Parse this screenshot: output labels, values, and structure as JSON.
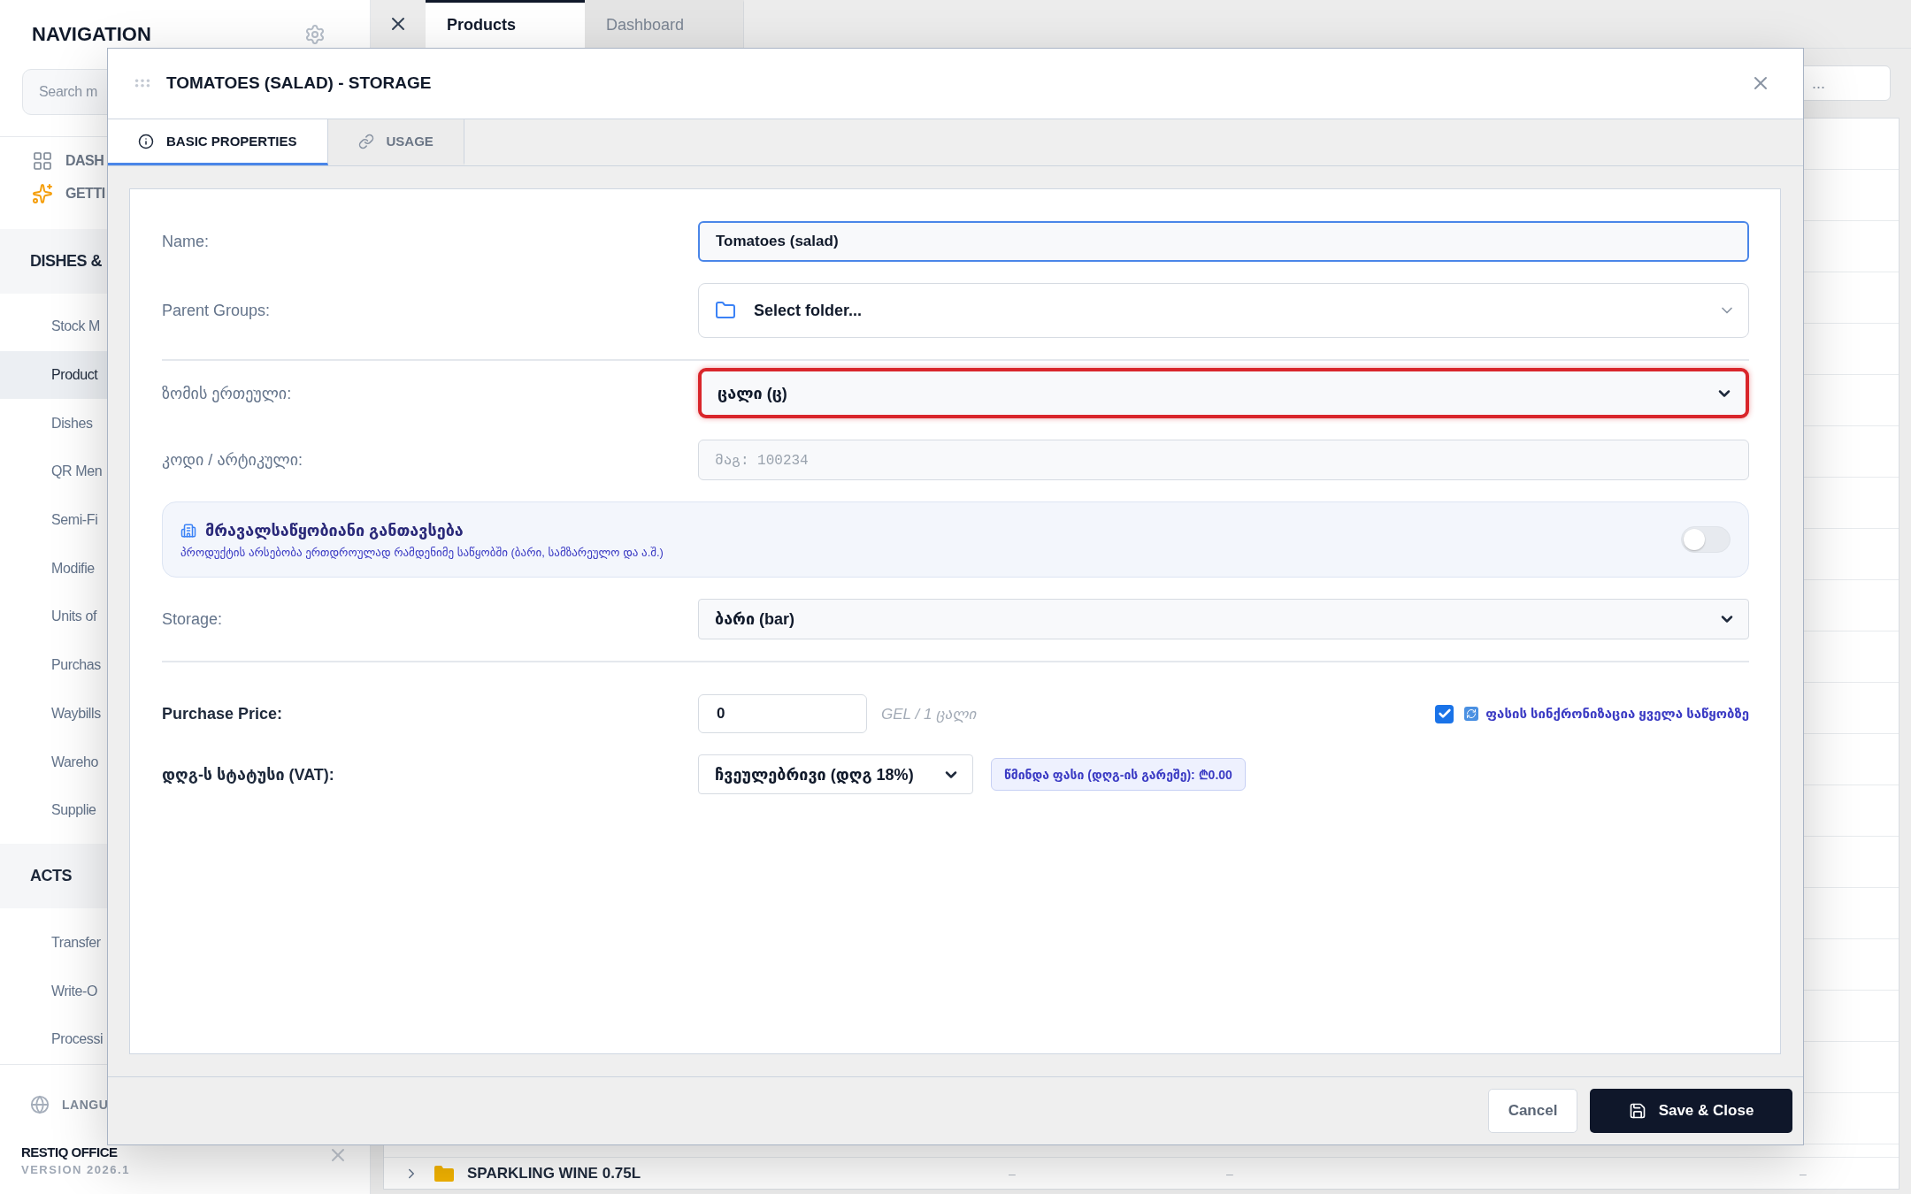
{
  "sidebar": {
    "title": "NAVIGATION",
    "search_placeholder": "Search m",
    "top_items": [
      {
        "label": "DASH"
      },
      {
        "label": "GETTI"
      }
    ],
    "sections": [
      {
        "title": "DISHES &",
        "items": [
          {
            "label": "Stock M",
            "selected": false
          },
          {
            "label": "Product",
            "selected": true
          },
          {
            "label": "Dishes",
            "selected": false
          },
          {
            "label": "QR Men",
            "selected": false
          },
          {
            "label": "Semi-Fi",
            "selected": false
          },
          {
            "label": "Modifie",
            "selected": false
          },
          {
            "label": "Units of",
            "selected": false
          },
          {
            "label": "Purchas",
            "selected": false
          },
          {
            "label": "Waybills",
            "selected": false
          },
          {
            "label": "Wareho",
            "selected": false
          },
          {
            "label": "Supplie",
            "selected": false
          }
        ]
      },
      {
        "title": "ACTS",
        "items": [
          {
            "label": "Transfer",
            "selected": false
          },
          {
            "label": "Write-O",
            "selected": false
          },
          {
            "label": "Processi",
            "selected": false
          }
        ]
      }
    ],
    "language": "LANGU",
    "brand": "RESTIQ OFFICE",
    "version": "VERSION 2026.1"
  },
  "tabs": [
    {
      "label": "Products",
      "selected": true
    },
    {
      "label": "Dashboard",
      "selected": false
    }
  ],
  "main": {
    "search_placeholder": "...",
    "rows": [
      {
        "label": "SPARKLING WINE 0.75L",
        "column_2": "–",
        "column_3": "–",
        "column_4": "–"
      }
    ]
  },
  "dialog": {
    "title": "TOMATOES (SALAD) - STORAGE",
    "tabs": [
      {
        "label": "BASIC PROPERTIES",
        "selected": true
      },
      {
        "label": "USAGE",
        "selected": false
      }
    ],
    "fields": [
      {
        "kind": "input",
        "label": "Name:",
        "value": "Tomatoes (salad)",
        "focused": true
      },
      {
        "kind": "folder",
        "label": "Parent Groups:",
        "value": "Select folder..."
      },
      {
        "kind": "divider"
      },
      {
        "kind": "select",
        "label": "ზომის ერთეული:",
        "value": "ცალი (ც)",
        "highlighted": true
      },
      {
        "kind": "input",
        "label": "კოდი / არტიკული:",
        "placeholder": "მაგ: 100234",
        "focused": false
      },
      {
        "kind": "toggle",
        "title": "მრავალსაწყობიანი განთავსება",
        "description": "პროდუქტის არსებობა ერთდროულად რამდენიმე საწყობში (ბარი, სამზარეულო და ა.შ.)",
        "on": false
      },
      {
        "kind": "select",
        "label": "Storage:",
        "value": "ბარი (bar)",
        "highlighted": false
      },
      {
        "kind": "divider"
      },
      {
        "kind": "price",
        "label": "Purchase Price:",
        "value": "0",
        "unit": "GEL / 1 ცალი",
        "sync": {
          "label": "ფასის სინქრონიზაცია ყველა საწყობზე",
          "checked": true
        }
      },
      {
        "kind": "vat",
        "label": "დღგ-ს სტატუსი (VAT):",
        "value": "ჩვეულებრივი (დღგ 18%)",
        "net_price": "წმინდა ფასი (დღგ-ის გარეშე): ₾0.00"
      }
    ],
    "cancel": "Cancel",
    "save": "Save & Close"
  }
}
